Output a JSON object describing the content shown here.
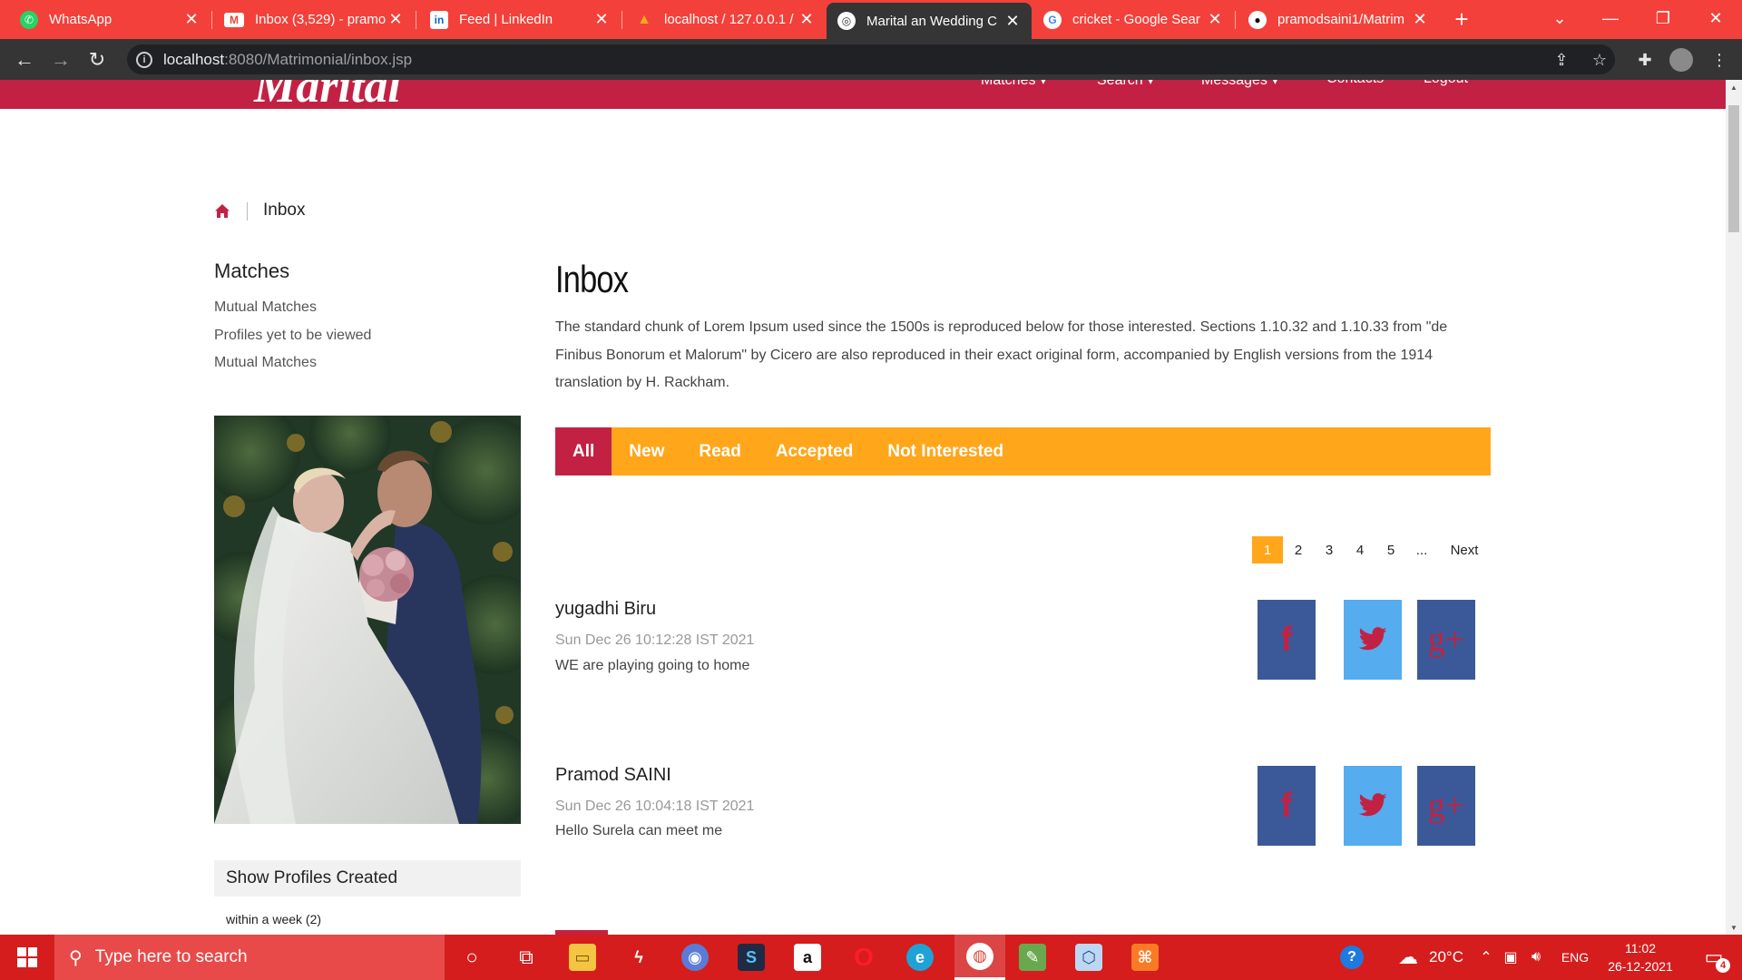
{
  "browser": {
    "tabs": [
      {
        "label": "WhatsApp",
        "icon": "whatsapp-icon",
        "icon_color": "#25d366"
      },
      {
        "label": "Inbox (3,529) - pramo",
        "icon": "gmail-icon",
        "icon_color": "#ffffff"
      },
      {
        "label": "Feed | LinkedIn",
        "icon": "linkedin-icon",
        "icon_color": "#0a66c2"
      },
      {
        "label": "localhost / 127.0.0.1 /",
        "icon": "phpmyadmin-icon",
        "icon_color": "#f6a623"
      },
      {
        "label": "Marital an Wedding C",
        "icon": "globe-icon",
        "icon_color": "#ffffff",
        "active": true
      },
      {
        "label": "cricket - Google Sear",
        "icon": "google-icon",
        "icon_color": "#ffffff"
      },
      {
        "label": "pramodsaini1/Matrim",
        "icon": "github-icon",
        "icon_color": "#ffffff"
      }
    ],
    "new_tab": "+",
    "close_glyph": "✕",
    "url_host": "localhost",
    "url_path": ":8080/Matrimonial/inbox.jsp"
  },
  "site": {
    "logo": "Marital",
    "nav": [
      "Matches ▾",
      "Search ▾",
      "Messages ▾",
      "Contacts",
      "Logout"
    ],
    "breadcrumb": "Inbox",
    "sidebar": {
      "title": "Matches",
      "links": [
        "Mutual Matches",
        "Profiles yet to be viewed",
        "Mutual Matches"
      ],
      "show_profiles_title": "Show Profiles Created",
      "show_profiles_items": [
        "within a week (2)"
      ]
    },
    "main": {
      "title": "Inbox",
      "intro": "The standard chunk of Lorem Ipsum used since the 1500s is reproduced below for those interested. Sections 1.10.32 and 1.10.33 from \"de Finibus Bonorum et Malorum\" by Cicero are also reproduced in their exact original form, accompanied by English versions from the 1914 translation by H. Rackham.",
      "filter_tabs": [
        "All",
        "New",
        "Read",
        "Accepted",
        "Not Interested"
      ],
      "active_filter": "All",
      "pager": [
        "1",
        "2",
        "3",
        "4",
        "5",
        "...",
        "Next"
      ],
      "current_page": "1",
      "messages": [
        {
          "name": "yugadhi Biru",
          "date": "Sun Dec 26 10:12:28 IST 2021",
          "text": "WE are playing going to home"
        },
        {
          "name": "Pramod SAINI",
          "date": "Sun Dec 26 10:04:18 IST 2021",
          "text": "Hello Surela can meet me"
        }
      ],
      "social": {
        "facebook": "f",
        "googleplus": "g+"
      }
    }
  },
  "taskbar": {
    "search_placeholder": "Type here to search",
    "weather": "20°C",
    "language": "ENG",
    "time": "11:02",
    "date": "26-12-2021",
    "notifications": "4"
  },
  "colors": {
    "brand": "#c32143",
    "accent": "#ffa61a",
    "tabstrip": "#f4403a",
    "taskbar": "#d51d1d"
  }
}
